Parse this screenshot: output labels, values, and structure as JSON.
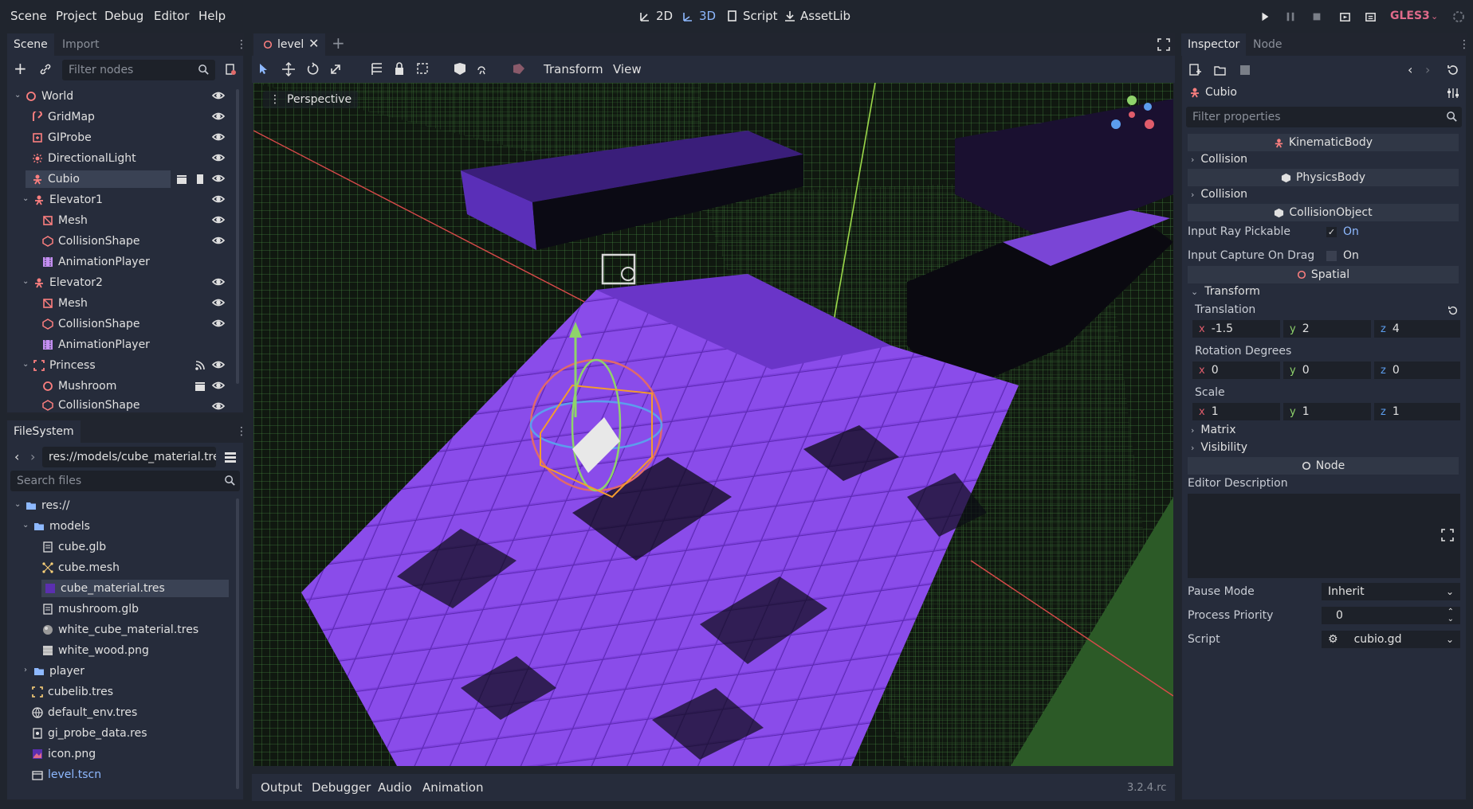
{
  "menu": [
    "Scene",
    "Project",
    "Debug",
    "Editor",
    "Help"
  ],
  "workspaces": [
    {
      "label": "2D",
      "active": false
    },
    {
      "label": "3D",
      "active": true
    },
    {
      "label": "Script",
      "active": false
    },
    {
      "label": "AssetLib",
      "active": false
    }
  ],
  "renderer": "GLES3",
  "scene_dock": {
    "tabs": [
      "Scene",
      "Import"
    ],
    "filter_placeholder": "Filter nodes",
    "nodes": [
      {
        "label": "World",
        "icon": "spatial-icon",
        "color": "#fc7f7f"
      },
      {
        "label": "GridMap",
        "icon": "gridmap-icon",
        "color": "#fc7f7f"
      },
      {
        "label": "GIProbe",
        "icon": "giprobe-icon",
        "color": "#fc7f7f"
      },
      {
        "label": "DirectionalLight",
        "icon": "light-icon",
        "color": "#fc7f7f"
      },
      {
        "label": "Cubio",
        "icon": "kinematic-body-icon",
        "color": "#fc7f7f"
      },
      {
        "label": "Elevator1",
        "icon": "kinematic-body-icon",
        "color": "#fc7f7f"
      },
      {
        "label": "Mesh",
        "icon": "mesh-icon",
        "color": "#fc7f7f"
      },
      {
        "label": "CollisionShape",
        "icon": "collision-shape-icon",
        "color": "#fc7f7f"
      },
      {
        "label": "AnimationPlayer",
        "icon": "animation-player-icon",
        "color": "#c38ef1"
      },
      {
        "label": "Elevator2",
        "icon": "kinematic-body-icon",
        "color": "#fc7f7f"
      },
      {
        "label": "Mesh",
        "icon": "mesh-icon",
        "color": "#fc7f7f"
      },
      {
        "label": "CollisionShape",
        "icon": "collision-shape-icon",
        "color": "#fc7f7f"
      },
      {
        "label": "AnimationPlayer",
        "icon": "animation-player-icon",
        "color": "#c38ef1"
      },
      {
        "label": "Princess",
        "icon": "area-icon",
        "color": "#fc7f7f"
      },
      {
        "label": "Mushroom",
        "icon": "spatial-icon",
        "color": "#fc7f7f"
      },
      {
        "label": "CollisionShape",
        "icon": "collision-shape-icon",
        "color": "#fc7f7f"
      }
    ]
  },
  "filesystem": {
    "tab": "FileSystem",
    "path": "res://models/cube_material.tre",
    "search_placeholder": "Search files",
    "items": [
      {
        "label": "res://"
      },
      {
        "label": "models"
      },
      {
        "label": "cube.glb"
      },
      {
        "label": "cube.mesh"
      },
      {
        "label": "cube_material.tres"
      },
      {
        "label": "mushroom.glb"
      },
      {
        "label": "white_cube_material.tres"
      },
      {
        "label": "white_wood.png"
      },
      {
        "label": "player"
      },
      {
        "label": "cubelib.tres"
      },
      {
        "label": "default_env.tres"
      },
      {
        "label": "gi_probe_data.res"
      },
      {
        "label": "icon.png"
      },
      {
        "label": "level.tscn"
      }
    ]
  },
  "editor": {
    "tab_label": "level",
    "toolbar_menus": [
      "Transform",
      "View"
    ],
    "viewport_label": "Perspective"
  },
  "bottom": {
    "tabs": [
      "Output",
      "Debugger",
      "Audio",
      "Animation"
    ],
    "version": "3.2.4.rc"
  },
  "inspector": {
    "tabs": [
      "Inspector",
      "Node"
    ],
    "object_name": "Cubio",
    "filter_placeholder": "Filter properties",
    "kinematic_body": "KinematicBody",
    "collision1": "Collision",
    "physics_body": "PhysicsBody",
    "collision2": "Collision",
    "collision_object": "CollisionObject",
    "input_ray_pickable": "Input Ray Pickable",
    "input_ray_value": "On",
    "input_capture": "Input Capture On Drag",
    "input_capture_value": "On",
    "spatial": "Spatial",
    "transform": "Transform",
    "translation": "Translation",
    "translation_values": {
      "x": "-1.5",
      "y": "2",
      "z": "4"
    },
    "rotation": "Rotation Degrees",
    "rotation_values": {
      "x": "0",
      "y": "0",
      "z": "0"
    },
    "scale": "Scale",
    "scale_values": {
      "x": "1",
      "y": "1",
      "z": "1"
    },
    "matrix": "Matrix",
    "visibility": "Visibility",
    "node": "Node",
    "editor_description": "Editor Description",
    "pause_mode": "Pause Mode",
    "pause_mode_value": "Inherit",
    "process_priority": "Process Priority",
    "process_priority_value": "0",
    "script": "Script",
    "script_value": "cubio.gd",
    "axis_labels": {
      "x": "x",
      "y": "y",
      "z": "z"
    }
  }
}
